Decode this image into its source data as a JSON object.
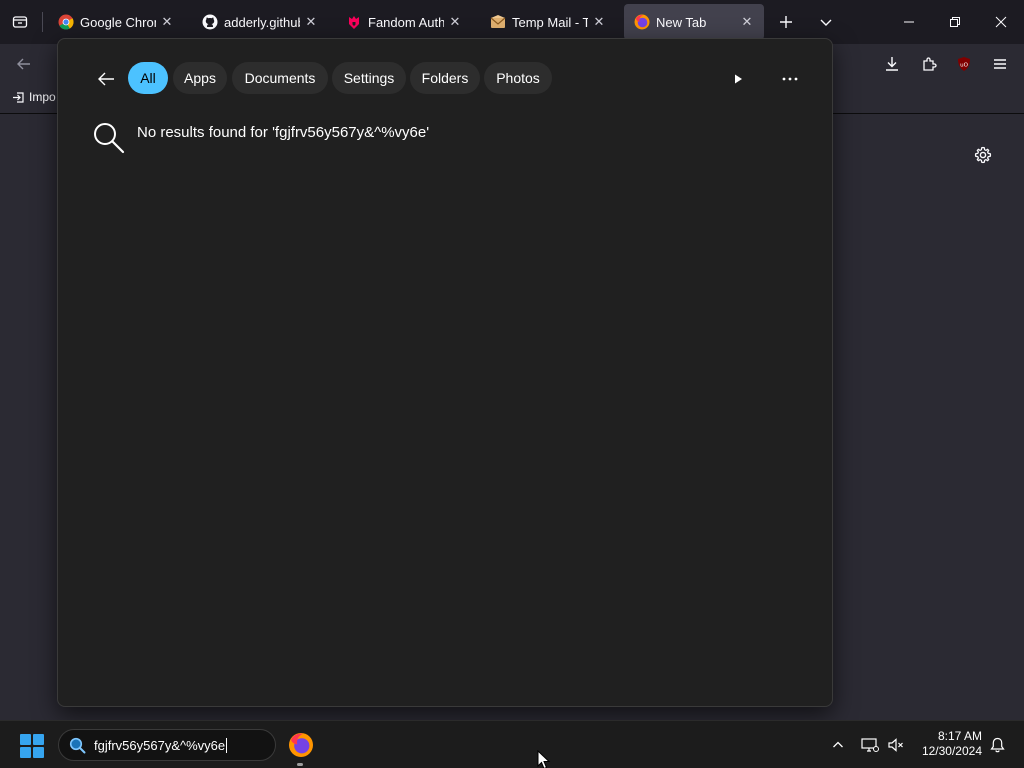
{
  "browser": {
    "tabs": [
      {
        "title": "Google Chrome",
        "favicon": "chrome-icon",
        "active": false
      },
      {
        "title": "adderly.github.io",
        "favicon": "github-icon",
        "active": false
      },
      {
        "title": "Fandom Auth",
        "favicon": "fandom-icon",
        "active": false
      },
      {
        "title": "Temp Mail - Temp",
        "favicon": "mail-icon",
        "active": false
      },
      {
        "title": "New Tab",
        "favicon": "firefox-icon",
        "active": true
      }
    ],
    "bookmarks": {
      "import_label": "Impo"
    }
  },
  "search_flyout": {
    "filters": [
      {
        "label": "All",
        "active": true
      },
      {
        "label": "Apps",
        "active": false
      },
      {
        "label": "Documents",
        "active": false
      },
      {
        "label": "Settings",
        "active": false
      },
      {
        "label": "Folders",
        "active": false
      },
      {
        "label": "Photos",
        "active": false
      }
    ],
    "no_results_text": "No results found for 'fgjfrv56y567y&^%vy6e'"
  },
  "taskbar": {
    "search_query": "fgjfrv56y567y&^%vy6e",
    "time": "8:17 AM",
    "date": "12/30/2024"
  },
  "colors": {
    "accent": "#4cc2ff",
    "flyout_bg": "#202020",
    "browser_bg": "#2b2a33",
    "start_blue": "#36a5f0"
  }
}
